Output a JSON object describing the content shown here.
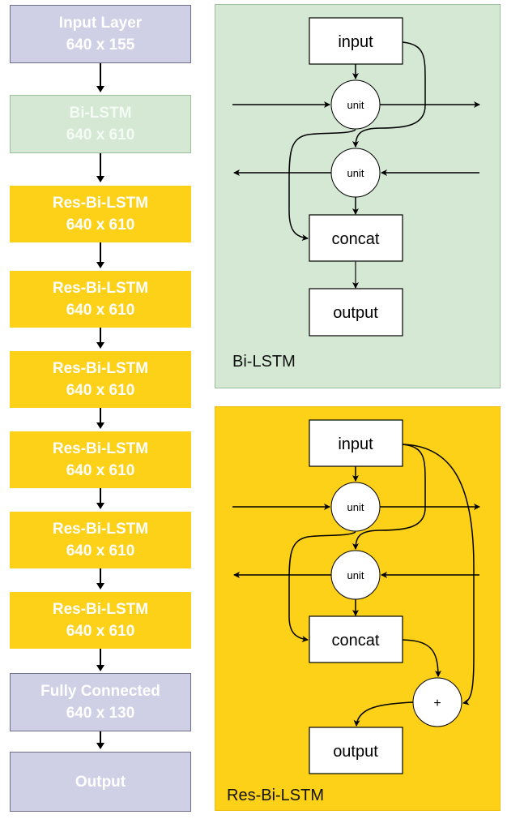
{
  "left_column": {
    "blocks": [
      {
        "line1": "Input Layer",
        "line2": "640 x 155",
        "kind": "input"
      },
      {
        "line1": "Bi-LSTM",
        "line2": "640 x 610",
        "kind": "bilstm"
      },
      {
        "line1": "Res-Bi-LSTM",
        "line2": "640 x 610",
        "kind": "res"
      },
      {
        "line1": "Res-Bi-LSTM",
        "line2": "640 x 610",
        "kind": "res"
      },
      {
        "line1": "Res-Bi-LSTM",
        "line2": "640 x 610",
        "kind": "res"
      },
      {
        "line1": "Res-Bi-LSTM",
        "line2": "640 x 610",
        "kind": "res"
      },
      {
        "line1": "Res-Bi-LSTM",
        "line2": "640 x 610",
        "kind": "res"
      },
      {
        "line1": "Res-Bi-LSTM",
        "line2": "640 x 610",
        "kind": "res"
      },
      {
        "line1": "Fully Connected",
        "line2": "640 x 130",
        "kind": "fc"
      },
      {
        "line1": "Output",
        "line2": "",
        "kind": "output"
      }
    ]
  },
  "bilstm_panel": {
    "title": "Bi-LSTM",
    "input_label": "input",
    "unit_forward_label": "unit",
    "unit_backward_label": "unit",
    "concat_label": "concat",
    "output_label": "output"
  },
  "res_panel": {
    "title": "Res-Bi-LSTM",
    "input_label": "input",
    "unit_forward_label": "unit",
    "unit_backward_label": "unit",
    "concat_label": "concat",
    "add_label": "+",
    "output_label": "output"
  },
  "colors": {
    "input_fc": "#cfcfe5",
    "bilstm": "#d4e8d4",
    "res_bilstm": "#fcd118"
  }
}
